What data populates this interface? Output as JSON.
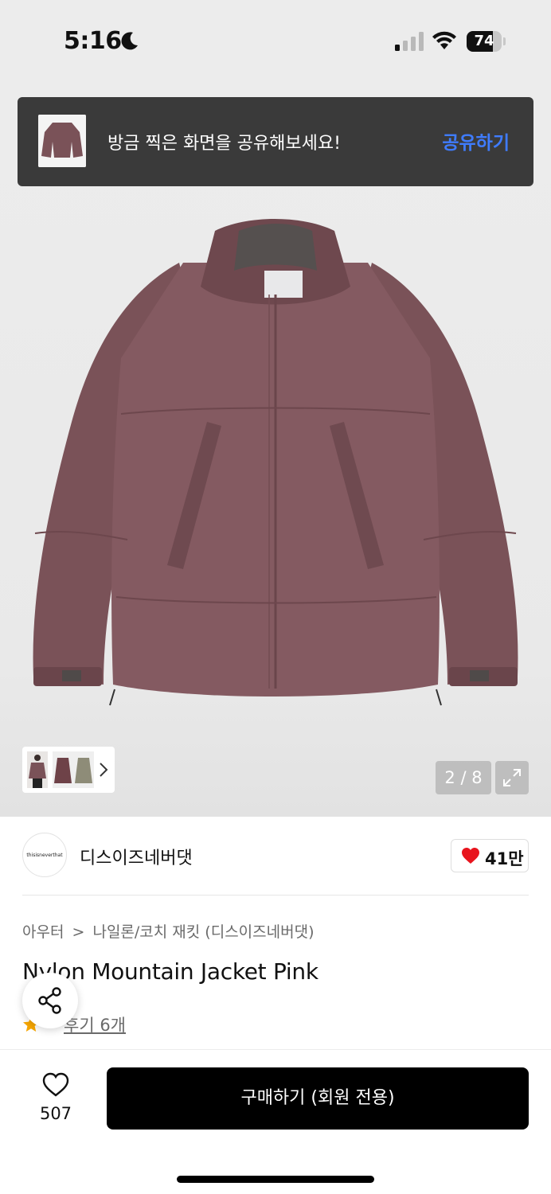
{
  "status_bar": {
    "time": "5:16",
    "battery": "74",
    "battery_level": 0.74
  },
  "toast": {
    "message": "방금 찍은 화면을 공유해보세요!",
    "action": "공유하기"
  },
  "gallery": {
    "counter": "2 / 8"
  },
  "brand": {
    "logo_text": "thisisneverthat",
    "name": "디스이즈네버댓",
    "likes": "41만"
  },
  "breadcrumb": {
    "category": "아우터",
    "separator": ">",
    "subcategory": "나일론/코치 재킷 (디스이즈네버댓)"
  },
  "product": {
    "title": "Nylon Mountain Jacket Pink",
    "rating": "",
    "reviews": "후기 6개"
  },
  "bottom_bar": {
    "wish_count": "507",
    "buy_label": "구매하기 (회원 전용)"
  },
  "colors": {
    "jacket": "#7a5258",
    "accent_blue": "#3f7cff",
    "heart_red": "#e8141d",
    "button": "#000000"
  }
}
